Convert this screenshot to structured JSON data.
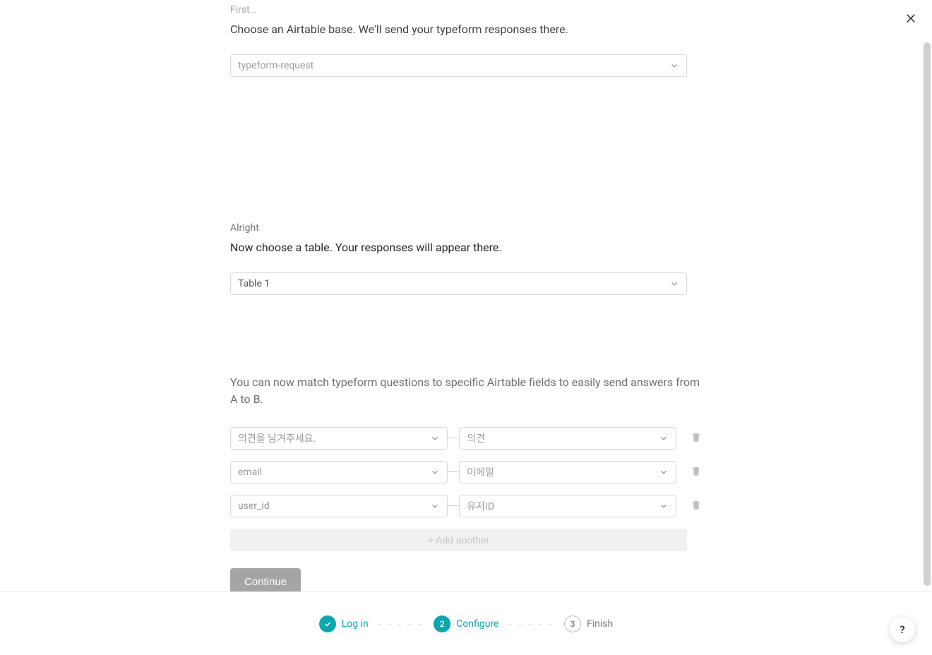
{
  "close": {},
  "section_base": {
    "hint": "First…",
    "title": "Choose an Airtable base. We'll send your typeform responses there.",
    "select_value": "typeform-request"
  },
  "section_table": {
    "hint": "Alright",
    "title": "Now choose a table. Your responses will appear there.",
    "select_value": "Table 1"
  },
  "section_map": {
    "description": "You can now match typeform questions to specific Airtable fields to easily send answers from A to B.",
    "rows": [
      {
        "left": "의견을 남겨주세요.",
        "right": "의견"
      },
      {
        "left": "email",
        "right": "이메일"
      },
      {
        "left": "user_id",
        "right": "유저ID"
      }
    ],
    "add_another": "+ Add another",
    "continue": "Continue"
  },
  "steps": {
    "login": "Log in",
    "configure": "Configure",
    "configure_num": "2",
    "finish": "Finish",
    "finish_num": "3"
  },
  "help": "?"
}
